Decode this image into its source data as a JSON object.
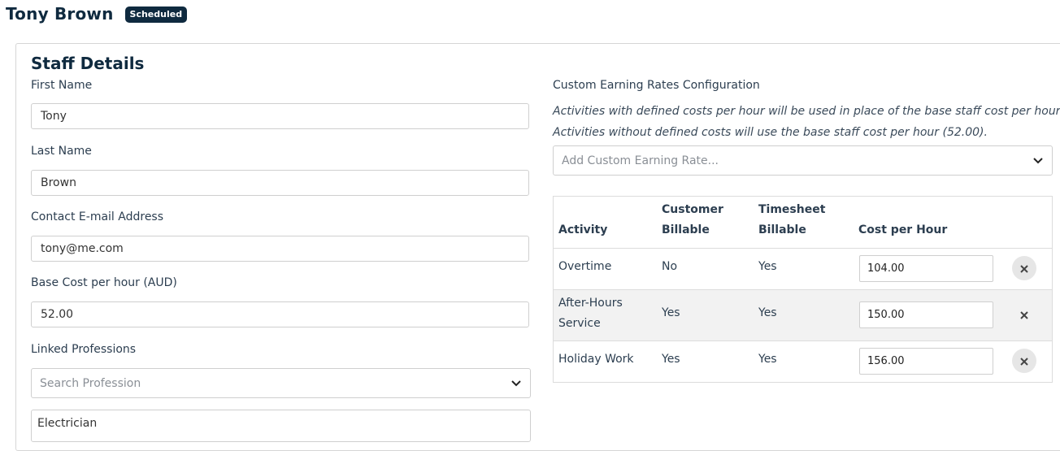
{
  "header": {
    "title": "Tony Brown",
    "status": "Scheduled"
  },
  "staff_details": {
    "title": "Staff Details",
    "first_name": {
      "label": "First Name",
      "value": "Tony"
    },
    "last_name": {
      "label": "Last Name",
      "value": "Brown"
    },
    "email": {
      "label": "Contact E-mail Address",
      "value": "tony@me.com"
    },
    "base_cost": {
      "label": "Base Cost per hour (AUD)",
      "value": "52.00"
    },
    "professions": {
      "label": "Linked Professions",
      "placeholder": "Search Profession",
      "selected": [
        "Electrician"
      ]
    }
  },
  "earning_rates": {
    "label": "Custom Earning Rates Configuration",
    "note_1": "Activities with defined costs per hour will be used in place of the base staff cost per hour",
    "note_2": "Activities without defined costs will use the base staff cost per hour (52.00).",
    "add_placeholder": "Add Custom Earning Rate...",
    "columns": {
      "activity": "Activity",
      "customer_billable_1": "Customer",
      "customer_billable_2": "Billable",
      "timesheet_billable_1": "Timesheet",
      "timesheet_billable_2": "Billable",
      "cost_per_hour": "Cost per Hour"
    },
    "rows": [
      {
        "activity_1": "Overtime",
        "activity_2": "",
        "customer_billable": "No",
        "timesheet_billable": "Yes",
        "cost": "104.00"
      },
      {
        "activity_1": "After-Hours",
        "activity_2": "Service",
        "customer_billable": "Yes",
        "timesheet_billable": "Yes",
        "cost": "150.00"
      },
      {
        "activity_1": "Holiday Work",
        "activity_2": "",
        "customer_billable": "Yes",
        "timesheet_billable": "Yes",
        "cost": "156.00"
      }
    ]
  },
  "icons": {
    "dropdown": "chevron-down-icon",
    "remove": "close-icon"
  },
  "colors": {
    "brand_dark": "#0f2a3f",
    "row_alt": "#f2f2f2",
    "border": "#cfcfcf"
  }
}
